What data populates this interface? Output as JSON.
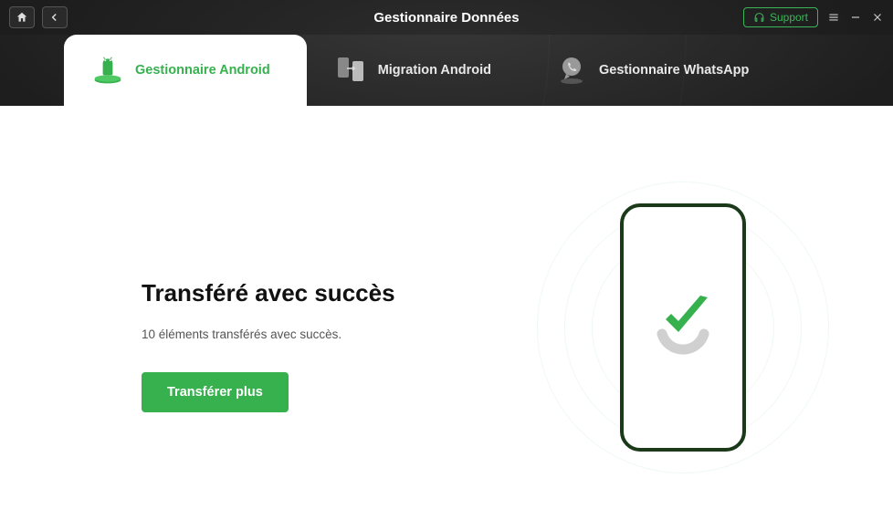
{
  "titlebar": {
    "title": "Gestionnaire Données",
    "support_label": "Support"
  },
  "tabs": [
    {
      "label": "Gestionnaire Android"
    },
    {
      "label": "Migration Android"
    },
    {
      "label": "Gestionnaire WhatsApp"
    }
  ],
  "main": {
    "heading": "Transféré avec succès",
    "subtext": "10 éléments transférés avec succès.",
    "button_label": "Transférer plus"
  }
}
